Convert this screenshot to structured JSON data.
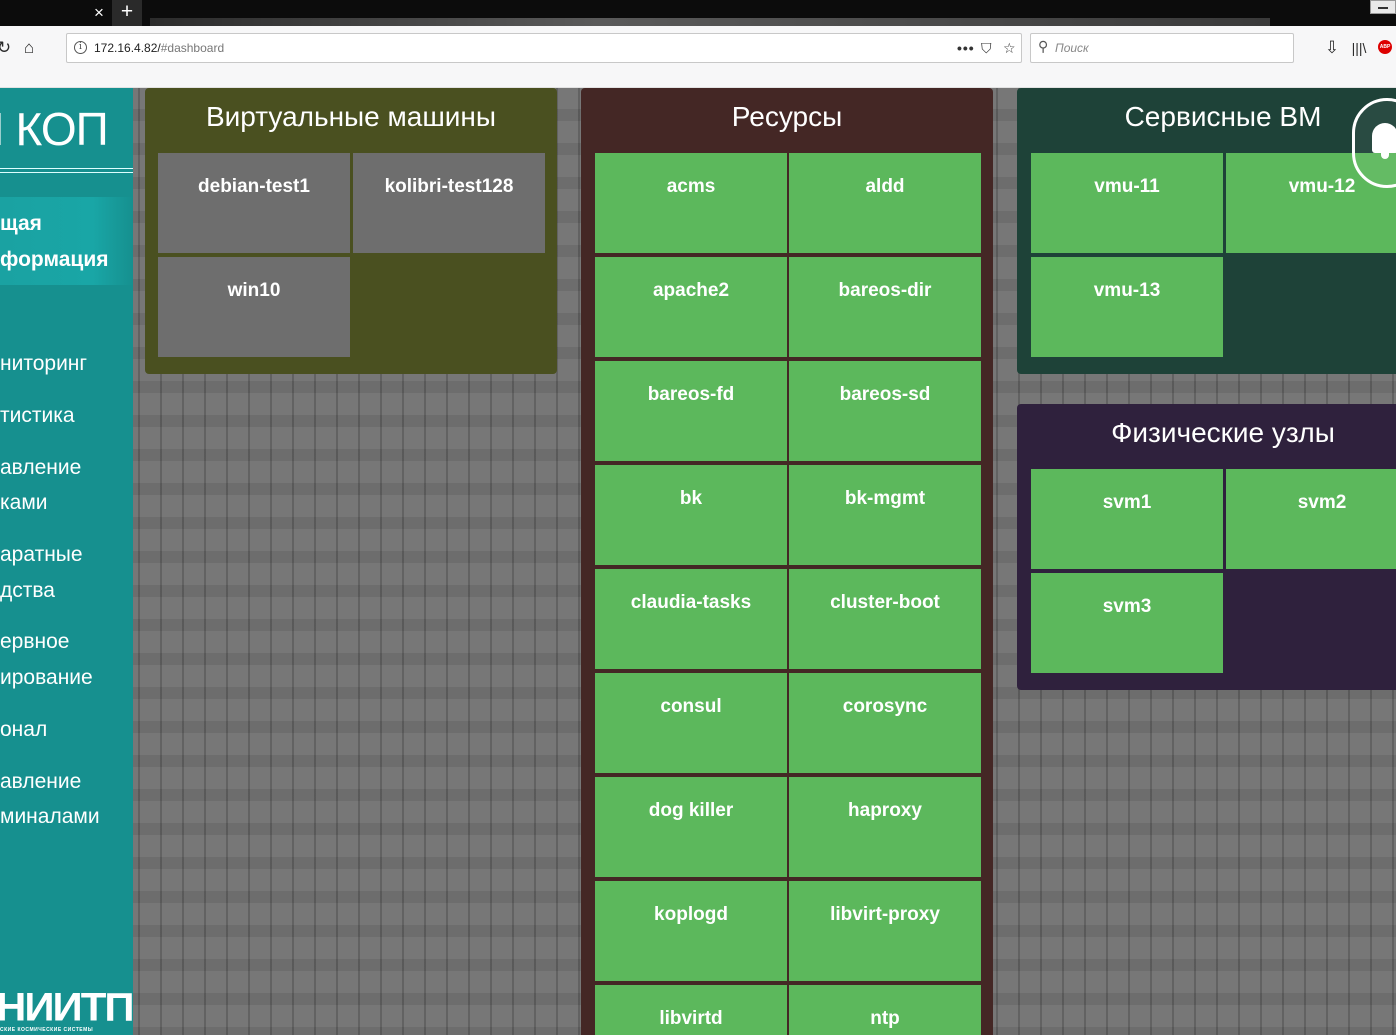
{
  "browser": {
    "tab_close": "×",
    "tab_new": "+",
    "url_host": "172.16.4.82/",
    "url_hash": "#dashboard",
    "search_placeholder": "Поиск",
    "adblock_label": "ABP"
  },
  "sidebar": {
    "brand": "I КОП",
    "items": [
      {
        "label": "щая",
        "bold": true
      },
      {
        "label": "формация",
        "bold": true
      },
      {
        "label": "ниторинг"
      },
      {
        "label": "тистика"
      },
      {
        "label": "авление"
      },
      {
        "label": "ками"
      },
      {
        "label": "аратные"
      },
      {
        "label": "дства"
      },
      {
        "label": "ервное"
      },
      {
        "label": "ирование"
      },
      {
        "label": "онал"
      },
      {
        "label": "авление"
      },
      {
        "label": "миналами"
      }
    ],
    "logo": "НИИТП",
    "logo_subtitle": "СКИЕ КОСМИЧЕСКИЕ СИСТЕМЫ"
  },
  "panels": {
    "vms": {
      "title": "Виртуальные машины",
      "color": "#4a5020",
      "tiles": [
        "debian-test1",
        "kolibri-test128",
        "win10"
      ]
    },
    "resources": {
      "title": "Ресурсы",
      "color": "#442725",
      "tiles": [
        "acms",
        "aldd",
        "apache2",
        "bareos-dir",
        "bareos-fd",
        "bareos-sd",
        "bk",
        "bk-mgmt",
        "claudia-tasks",
        "cluster-boot",
        "consul",
        "corosync",
        "dog killer",
        "haproxy",
        "koplogd",
        "libvirt-proxy",
        "libvirtd",
        "ntp"
      ]
    },
    "service_vms": {
      "title": "Сервисные ВМ",
      "color": "#1e4238",
      "tiles": [
        "vmu-11",
        "vmu-12",
        "vmu-13"
      ]
    },
    "physical_nodes": {
      "title": "Физические узлы",
      "color": "#2f213d",
      "tiles": [
        "svm1",
        "svm2",
        "svm3"
      ]
    }
  },
  "colors": {
    "tile_green": "#5cb85c",
    "tile_grey": "#6e6e6e",
    "sidebar": "#16908f"
  }
}
